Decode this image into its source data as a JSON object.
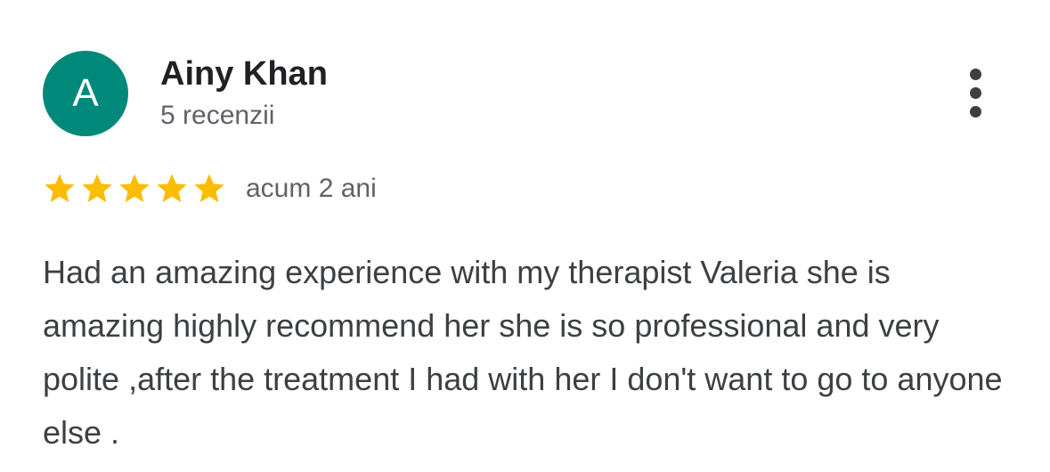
{
  "review": {
    "avatar_letter": "A",
    "avatar_color": "#00897b",
    "author_name": "Ainy Khan",
    "review_count": "5 recenzii",
    "rating": 5,
    "rating_max": 5,
    "star_color": "#fbbc04",
    "date": "acum 2 ani",
    "text": "Had an amazing experience with my therapist Valeria she is amazing highly recommend her she is so professional and very polite ,after the treatment I had with her I don't want to go to anyone else .",
    "more_icon": "more-vert-icon"
  }
}
